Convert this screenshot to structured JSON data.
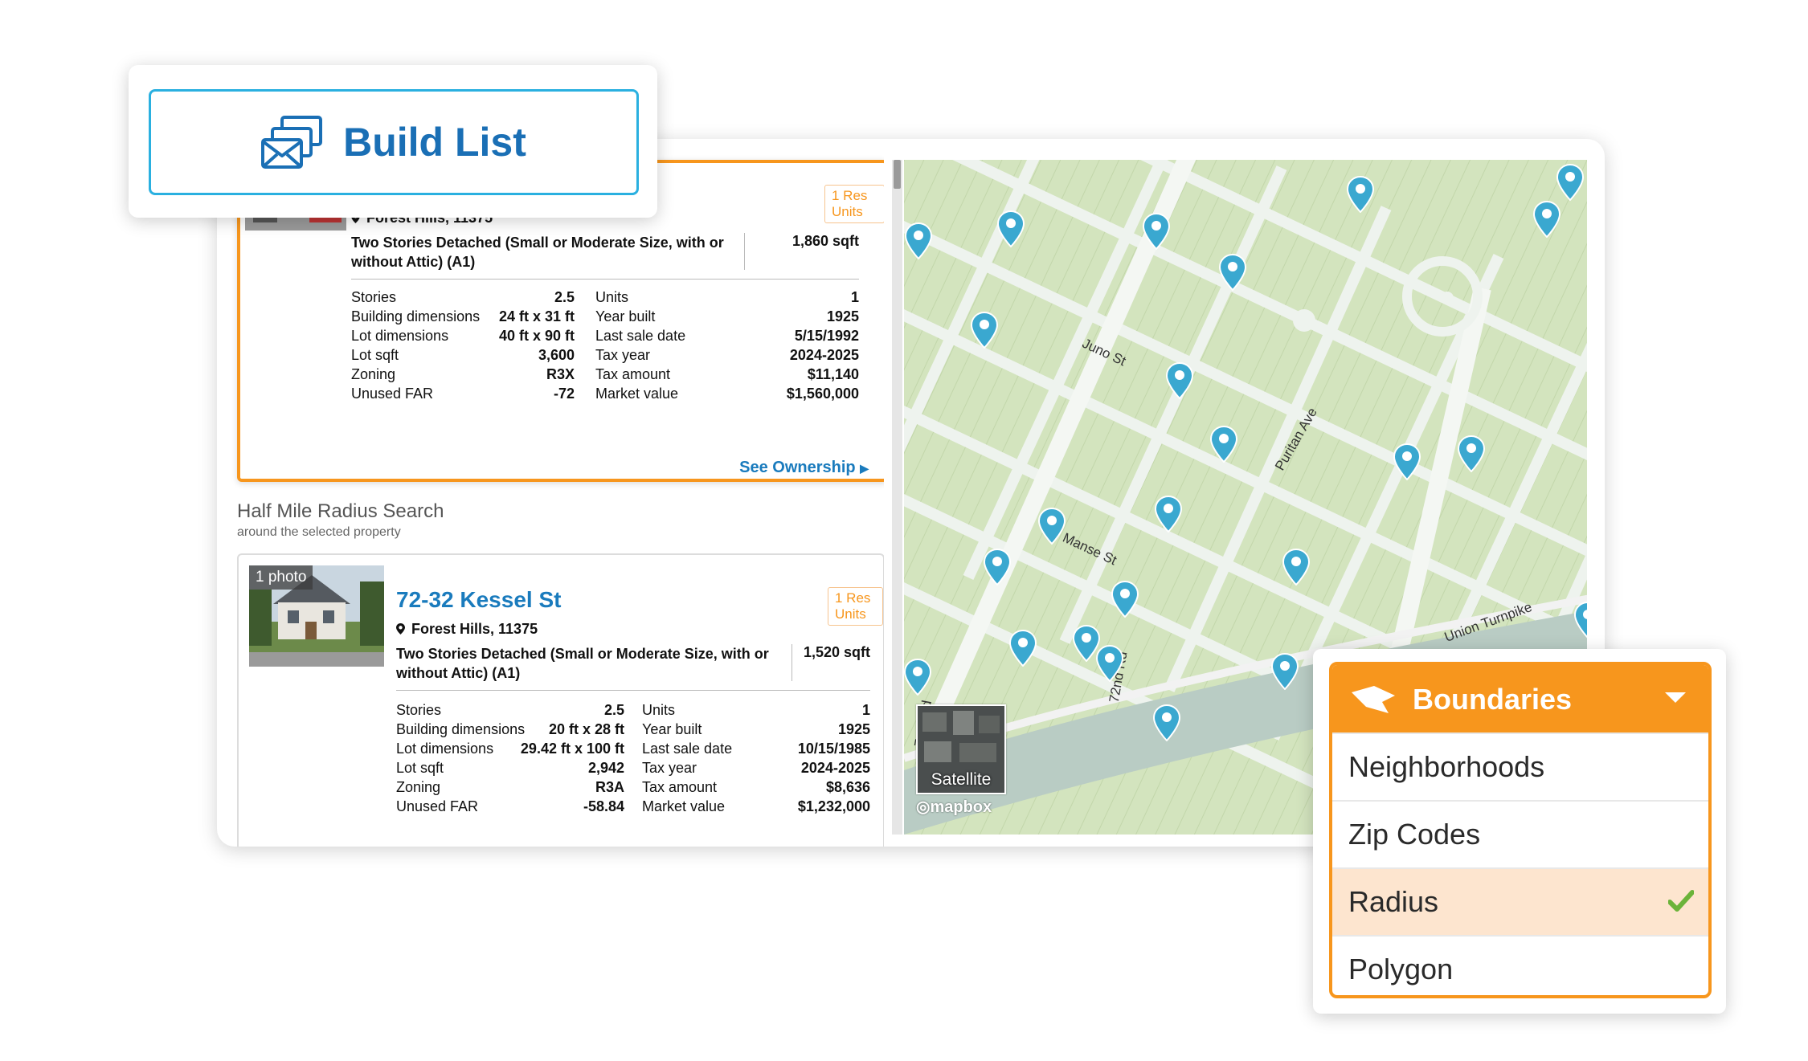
{
  "build_list": {
    "label": "Build List",
    "icon": "envelope-stack-icon"
  },
  "selected_property": {
    "units_badge": "1 Res Units",
    "location": "Forest Hills, 11375",
    "building_class": "Two Stories Detached (Small or Moderate Size, with or without Attic) (A1)",
    "sqft": "1,860 sqft",
    "stats_left": [
      {
        "label": "Stories",
        "value": "2.5"
      },
      {
        "label": "Building dimensions",
        "value": "24 ft x 31 ft"
      },
      {
        "label": "Lot dimensions",
        "value": "40 ft x 90 ft"
      },
      {
        "label": "Lot sqft",
        "value": "3,600"
      },
      {
        "label": "Zoning",
        "value": "R3X"
      },
      {
        "label": "Unused FAR",
        "value": "-72"
      }
    ],
    "stats_right": [
      {
        "label": "Units",
        "value": "1"
      },
      {
        "label": "Year built",
        "value": "1925"
      },
      {
        "label": "Last sale date",
        "value": "5/15/1992"
      },
      {
        "label": "Tax year",
        "value": "2024-2025"
      },
      {
        "label": "Tax amount",
        "value": "$11,140"
      },
      {
        "label": "Market value",
        "value": "$1,560,000"
      }
    ],
    "see_ownership": "See Ownership"
  },
  "radius_search": {
    "title": "Half Mile Radius Search",
    "subtitle": "around the selected property"
  },
  "result_property": {
    "photo_count": "1 photo",
    "address": "72-32 Kessel St",
    "units_badge": "1 Res Units",
    "location": "Forest Hills, 11375",
    "building_class": "Two Stories Detached (Small or Moderate Size, with or without Attic) (A1)",
    "sqft": "1,520 sqft",
    "stats_left": [
      {
        "label": "Stories",
        "value": "2.5"
      },
      {
        "label": "Building dimensions",
        "value": "20 ft x 28 ft"
      },
      {
        "label": "Lot dimensions",
        "value": "29.42 ft x 100 ft"
      },
      {
        "label": "Lot sqft",
        "value": "2,942"
      },
      {
        "label": "Zoning",
        "value": "R3A"
      },
      {
        "label": "Unused FAR",
        "value": "-58.84"
      }
    ],
    "stats_right": [
      {
        "label": "Units",
        "value": "1"
      },
      {
        "label": "Year built",
        "value": "1925"
      },
      {
        "label": "Last sale date",
        "value": "10/15/1985"
      },
      {
        "label": "Tax year",
        "value": "2024-2025"
      },
      {
        "label": "Tax amount",
        "value": "$8,636"
      },
      {
        "label": "Market value",
        "value": "$1,232,000"
      }
    ]
  },
  "map": {
    "streets": [
      "Juno St",
      "Manse St",
      "Puritan Ave",
      "Union Turnpike",
      "72nd Rd",
      "71st Rd"
    ],
    "satellite_label": "Satellite",
    "attribution": "mapbox",
    "marker_color": "#3aa8d0"
  },
  "boundaries": {
    "title": "Boundaries",
    "options": [
      {
        "label": "Neighborhoods",
        "selected": false
      },
      {
        "label": "Zip Codes",
        "selected": false
      },
      {
        "label": "Radius",
        "selected": true
      },
      {
        "label": "Polygon",
        "selected": false
      }
    ],
    "accent_color": "#f7961d"
  }
}
